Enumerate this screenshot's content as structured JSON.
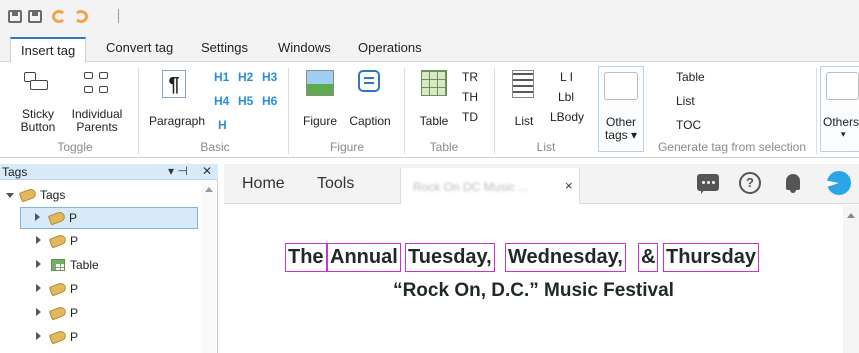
{
  "quick_access": {
    "icons": [
      "save-icon",
      "save-all-icon",
      "undo-icon",
      "redo-icon"
    ]
  },
  "tabs": [
    {
      "label": "Insert tag",
      "active": true
    },
    {
      "label": "Convert tag"
    },
    {
      "label": "Settings"
    },
    {
      "label": "Windows"
    },
    {
      "label": "Operations"
    }
  ],
  "ribbon": {
    "toggle": {
      "group_label": "Toggle",
      "sticky_label_1": "Sticky",
      "sticky_label_2": "Button",
      "individual_label_1": "Individual",
      "individual_label_2": "Parents"
    },
    "basic": {
      "group_label": "Basic",
      "paragraph_label": "Paragraph",
      "headings": [
        "H1",
        "H2",
        "H3",
        "H4",
        "H5",
        "H6",
        "H"
      ]
    },
    "figure": {
      "group_label": "Figure",
      "figure_label": "Figure",
      "caption_label": "Caption"
    },
    "table": {
      "group_label": "Table",
      "table_label": "Table",
      "tr": "TR",
      "th": "TH",
      "td": "TD"
    },
    "list": {
      "group_label": "List",
      "list_label": "List",
      "li": "L I",
      "lbl": "Lbl",
      "lbody": "LBody"
    },
    "other_tags": {
      "label_1": "Other",
      "label_2": "tags ▾"
    },
    "generate": {
      "group_label": "Generate tag from selection",
      "table": "Table",
      "list": "List",
      "toc": "TOC"
    },
    "others": {
      "label": "Others",
      "arrow": "▾"
    }
  },
  "tags_panel": {
    "title": "Tags",
    "pin": "▾ ⊣",
    "close": "✕",
    "tree": [
      {
        "label": "Tags",
        "expanded": true,
        "icon": "tag-icon"
      },
      {
        "label": "P",
        "icon": "tag-icon",
        "selected": true
      },
      {
        "label": "P",
        "icon": "tag-icon"
      },
      {
        "label": "Table",
        "icon": "table-icon"
      },
      {
        "label": "P",
        "icon": "tag-icon"
      },
      {
        "label": "P",
        "icon": "tag-icon"
      },
      {
        "label": "P",
        "icon": "tag-icon"
      }
    ]
  },
  "navbar": {
    "home": "Home",
    "tools": "Tools",
    "doc_tab_name": "Rock On DC Music ...",
    "doc_tab_close": "×",
    "help": "?"
  },
  "document": {
    "headline_words": [
      "The",
      "Annual",
      "Tuesday,",
      "Wednesday,",
      "&",
      "Thursday"
    ],
    "subheading": "“Rock On, D.C.” Music Festival"
  },
  "colors": {
    "accent": "#2b78c5",
    "heading_link": "#2b8ed6",
    "tag_highlight": "#cc33cc",
    "selection": "#d6eaf9"
  }
}
